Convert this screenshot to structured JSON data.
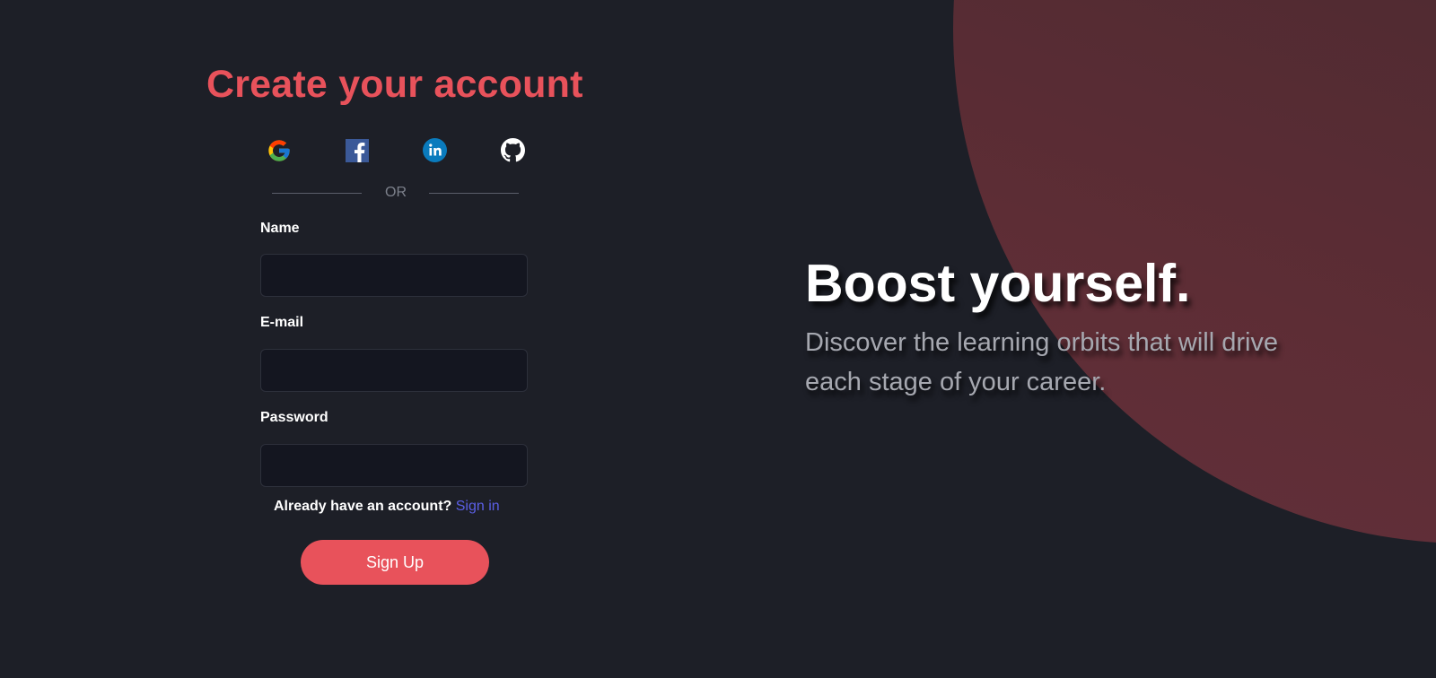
{
  "form": {
    "title": "Create your account",
    "social": [
      {
        "icon": "google-icon"
      },
      {
        "icon": "facebook-icon"
      },
      {
        "icon": "linkedin-icon"
      },
      {
        "icon": "github-icon"
      }
    ],
    "divider_text": "OR",
    "fields": {
      "name": {
        "label": "Name",
        "value": "",
        "placeholder": ""
      },
      "email": {
        "label": "E-mail",
        "value": "",
        "placeholder": ""
      },
      "password": {
        "label": "Password",
        "value": "",
        "placeholder": ""
      }
    },
    "already_text": "Already have an account?",
    "signin_link": "Sign in",
    "signup_button": "Sign Up"
  },
  "hero": {
    "title": "Boost yourself.",
    "subtitle": "Discover the learning orbits that will drive each stage of your career."
  },
  "colors": {
    "background": "#1d1f27",
    "accent": "#e8525b",
    "link": "#5b5fe6",
    "input_bg": "#141620",
    "circle": "#5d2d35"
  }
}
